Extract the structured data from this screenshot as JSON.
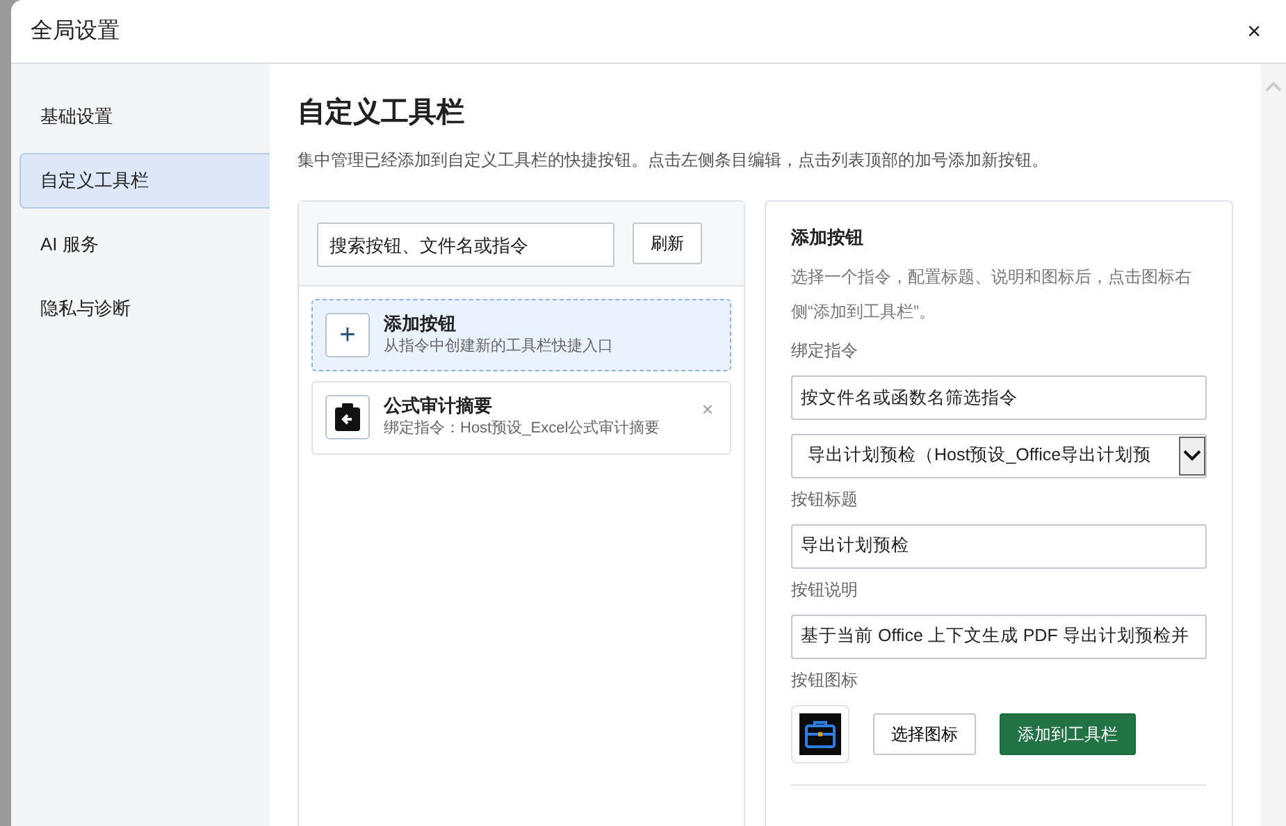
{
  "dialog": {
    "title": "全局设置",
    "close": "×"
  },
  "sidebar": {
    "items": [
      {
        "label": "基础设置",
        "selected": false
      },
      {
        "label": "自定义工具栏",
        "selected": true
      },
      {
        "label": "AI 服务",
        "selected": false
      },
      {
        "label": "隐私与诊断",
        "selected": false
      }
    ]
  },
  "page": {
    "title": "自定义工具栏",
    "description": "集中管理已经添加到自定义工具栏的快捷按钮。点击左侧条目编辑，点击列表顶部的加号添加新按钮。"
  },
  "list_panel": {
    "search": {
      "placeholder": "搜索按钮、文件名或指令"
    },
    "refresh_button": "刷新",
    "items": [
      {
        "kind": "add",
        "icon": "+",
        "title": "添加按钮",
        "subtitle": "从指令中创建新的工具栏快捷入口",
        "selected": true
      },
      {
        "kind": "command",
        "title": "公式审计摘要",
        "subtitle": "绑定指令：Host预设_Excel公式审计摘要",
        "selected": false,
        "remove": "×"
      }
    ]
  },
  "editor": {
    "title": "添加按钮",
    "hint": "选择一个指令，配置标题、说明和图标后，点击图标右侧“添加到工具栏”。",
    "fields": [
      {
        "kind": "search",
        "label": "绑定指令",
        "placeholder": "按文件名或函数名筛选指令"
      },
      {
        "kind": "select",
        "value": "导出计划预检（Host预设_Office导出计划预"
      },
      {
        "kind": "text",
        "label": "按钮标题",
        "value": "导出计划预检"
      },
      {
        "kind": "text",
        "label": "按钮说明",
        "value": "基于当前 Office 上下文生成 PDF 导出计划预检并"
      }
    ],
    "icon_label": "按钮图标",
    "choose_button": "选择图标",
    "add_button": "添加到工具栏"
  }
}
